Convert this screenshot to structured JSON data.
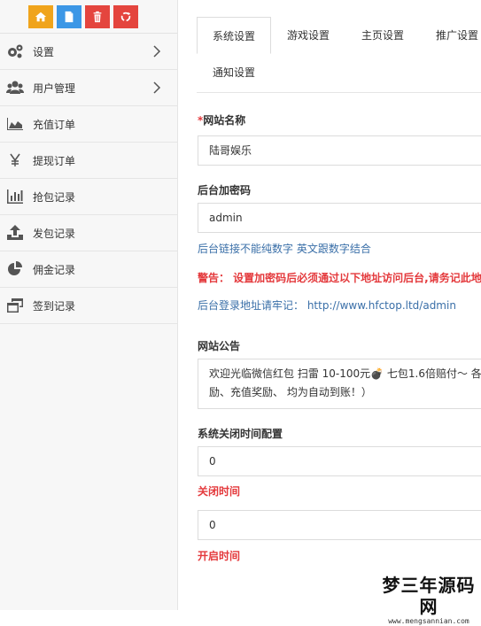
{
  "colors": {
    "home_button": "#f0a41c",
    "doc_button": "#3c97e6",
    "trash_button": "#e4453e",
    "refresh_button": "#e4453e",
    "warning_text": "#e4393c",
    "link_text": "#3a6fa8"
  },
  "toolbar": {
    "buttons": [
      {
        "icon": "home-icon"
      },
      {
        "icon": "document-icon"
      },
      {
        "icon": "trash-icon"
      },
      {
        "icon": "refresh-icon"
      }
    ]
  },
  "sidebar": {
    "items": [
      {
        "label": "设置",
        "icon": "gears-icon",
        "has_arrow": true
      },
      {
        "label": "用户管理",
        "icon": "users-icon",
        "has_arrow": true
      },
      {
        "label": "充值订单",
        "icon": "area-chart-icon"
      },
      {
        "label": "提现订单",
        "icon": "yen-icon"
      },
      {
        "label": "抢包记录",
        "icon": "bar-chart-icon"
      },
      {
        "label": "发包记录",
        "icon": "upload-icon"
      },
      {
        "label": "佣金记录",
        "icon": "pie-chart-icon"
      },
      {
        "label": "签到记录",
        "icon": "window-restore-icon"
      }
    ]
  },
  "tabs": [
    {
      "label": "系统设置",
      "active": true
    },
    {
      "label": "游戏设置"
    },
    {
      "label": "主页设置"
    },
    {
      "label": "推广设置"
    },
    {
      "label": "通知设置"
    }
  ],
  "form": {
    "site_name": {
      "required_mark": "*",
      "label": "网站名称",
      "value": "陆哥娱乐"
    },
    "admin_password": {
      "label": "后台加密码",
      "value": "admin",
      "hint": "后台链接不能纯数字 英文跟数字结合",
      "warning": "警告： 设置加密码后必须通过以下地址访问后台,请务记此地址",
      "address": "后台登录地址请牢记： http://www.hfctop.ltd/admin"
    },
    "announcement": {
      "label": "网站公告",
      "line1": "欢迎光临微信红包 扫雷  10-100元💣 七包1.6倍赔付～ 各",
      "line2": "励、充值奖励、 均为自动到账！）"
    },
    "close_config": {
      "label": "系统关闭时间配置",
      "close_value": "0",
      "close_label": "关闭时间",
      "open_value": "0",
      "open_label": "开启时间"
    }
  },
  "watermark": {
    "title": "梦三年源码网",
    "url": "www.mengsannian.com"
  }
}
